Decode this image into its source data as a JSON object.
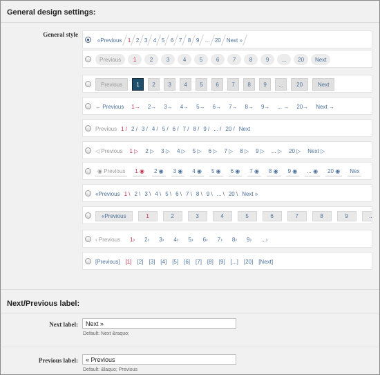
{
  "general_section": {
    "title": "General design settings:",
    "style_label": "General style",
    "rows": [
      {
        "items": [
          "«Previous",
          "1",
          "2",
          "3",
          "4",
          "5",
          "6",
          "7",
          "8",
          "9",
          "...",
          "20",
          "Next »"
        ]
      },
      {
        "items": [
          "Previous",
          "1",
          "2",
          "3",
          "4",
          "5",
          "6",
          "7",
          "8",
          "9",
          "...",
          "20",
          "Next"
        ]
      },
      {
        "items": [
          "Previous",
          "1",
          "2",
          "3",
          "4",
          "5",
          "6",
          "7",
          "8",
          "9",
          "...",
          "20",
          "Next"
        ]
      },
      {
        "items": [
          "← Previous",
          "1→",
          "2→",
          "3→",
          "4→",
          "5→",
          "6→",
          "7→",
          "8→",
          "9→",
          "... →",
          "20→",
          "Next →"
        ]
      },
      {
        "items": [
          "Previous",
          "1 /",
          "2 /",
          "3 /",
          "4 /",
          "5 /",
          "6 /",
          "7 /",
          "8 /",
          "9 /",
          "... /",
          "20 /",
          "Next"
        ]
      },
      {
        "items": [
          "◁ Previous",
          "1 ▷",
          "2 ▷",
          "3 ▷",
          "4 ▷",
          "5 ▷",
          "6 ▷",
          "7 ▷",
          "8 ▷",
          "9 ▷",
          "... ▷",
          "20 ▷",
          "Next ▷"
        ]
      },
      {
        "items": [
          "◉ Previous",
          "1 ◉",
          "2 ◉",
          "3 ◉",
          "4 ◉",
          "5 ◉",
          "6 ◉",
          "7 ◉",
          "8 ◉",
          "9 ◉",
          "... ◉",
          "20 ◉",
          "Nex"
        ]
      },
      {
        "items": [
          "«Previous",
          "1 \\",
          "2 \\",
          "3 \\",
          "4 \\",
          "5 \\",
          "6 \\",
          "7 \\",
          "8 \\",
          "9 \\",
          "... \\",
          "20 \\",
          "Next »"
        ]
      },
      {
        "items": [
          "«Previous",
          "1",
          "2",
          "3",
          "4",
          "5",
          "6",
          "7",
          "8",
          "9",
          "..."
        ]
      },
      {
        "items": [
          "‹ Previous",
          "1›",
          "2›",
          "3›",
          "4›",
          "5›",
          "6›",
          "7›",
          "8›",
          "9›",
          "...›"
        ]
      },
      {
        "items": [
          "[Previous]",
          "[1]",
          "[2]",
          "[3]",
          "[4]",
          "[5]",
          "[6]",
          "[7]",
          "[8]",
          "[9]",
          "[...]",
          "[20]",
          "[Next]"
        ]
      }
    ],
    "current_index": 1,
    "selected_row": 0
  },
  "nav_section": {
    "title": "Next/Previous label:",
    "next_label": "Next label:",
    "next_value": "Next »",
    "next_default": "Default: Next &raquo;",
    "prev_label": "Previous label:",
    "prev_value": "« Previous",
    "prev_default": "Default: &laquo; Previous"
  }
}
